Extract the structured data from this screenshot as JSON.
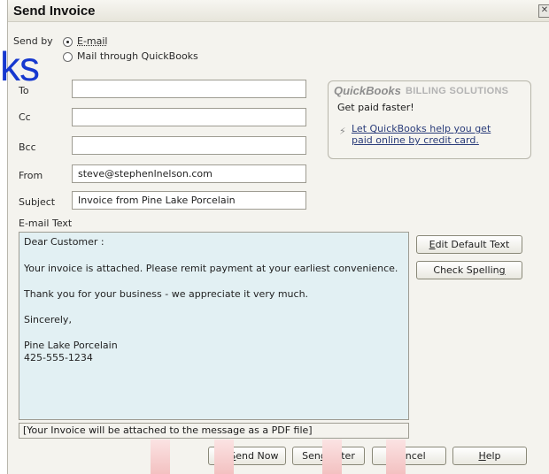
{
  "window": {
    "title": "Send Invoice",
    "close_glyph": "✕"
  },
  "send_by": {
    "label": "Send by",
    "options": [
      {
        "label": "E-mail",
        "selected": true
      },
      {
        "label": "Mail through QuickBooks",
        "selected": false
      }
    ]
  },
  "form": {
    "to_label": "To",
    "to_value": "",
    "cc_label": "Cc",
    "cc_value": "",
    "bcc_label": "Bcc",
    "bcc_value": "",
    "from_label": "From",
    "from_value": "steve@stephenlnelson.com",
    "subject_label": "Subject",
    "subject_value": "Invoice from Pine Lake Porcelain",
    "email_text_label": "E-mail Text"
  },
  "promo": {
    "brand": "QuickBooks",
    "sub": "BILLING SOLUTIONS",
    "tagline": "Get paid faster!",
    "link": "Let QuickBooks help you get paid online by credit card.",
    "icon": "lightning-icon"
  },
  "email_body": {
    "lines": [
      "Dear Customer :",
      "Your invoice is attached.  Please remit payment at your earliest convenience.",
      "Thank you for your business - we appreciate it very much.",
      "Sincerely,",
      "Pine Lake Porcelain",
      "425-555-1234"
    ]
  },
  "attach_note": "[Your Invoice will be attached to the message as a PDF file]",
  "side_buttons": {
    "edit_default_pre": "",
    "edit_default_u": "E",
    "edit_default_post": "dit Default Text",
    "check_spelling_pre": "Check Spellin",
    "check_spelling_u": "g",
    "check_spelling_post": ""
  },
  "bottom_buttons": {
    "send_now_u": "S",
    "send_now_post": "end Now",
    "send_later_pre": "Sen",
    "send_later_u": "d",
    "send_later_post": " Later",
    "cancel_u": "C",
    "cancel_post": "ancel",
    "help_u": "H",
    "help_post": "elp",
    "send_icon": "lightning-icon"
  },
  "watermark": {
    "text": "ks",
    "colors": {
      "text": "#1638cf",
      "bar": "#f3c1c1"
    }
  },
  "colors": {
    "email_body_bg": "#e2f0f3",
    "window_bg": "#f4f3ee"
  }
}
